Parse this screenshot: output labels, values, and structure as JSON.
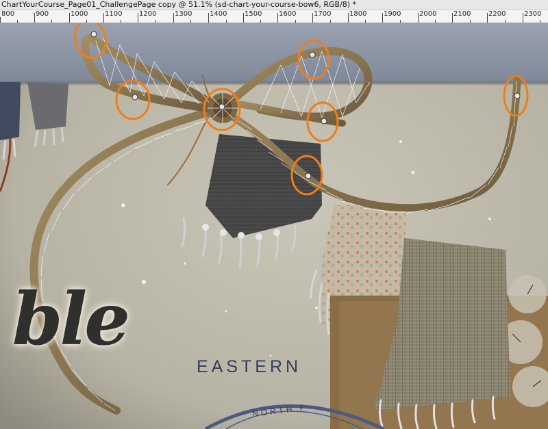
{
  "window": {
    "title": "ChartYourCourse_Page01_ChallengePage copy @ 51.1% (sd-chart-your-course-bow6, RGB/8) *"
  },
  "ruler": {
    "ticks": [
      "800",
      "900",
      "1000",
      "1100",
      "1200",
      "1300",
      "1400",
      "1500",
      "1600",
      "1700",
      "1800",
      "1900",
      "2000",
      "2100",
      "2200",
      "2300"
    ]
  },
  "canvas": {
    "eastern_text": "EASTERN",
    "north_text": "NORTH F",
    "script_text": "ble"
  },
  "colors": {
    "handle_ring": "#f07d19",
    "bow_rope": "#8a7550",
    "mesh_lines": "#ffffff",
    "paper": "#bdb9ab",
    "slate_strip": "#8a93a3"
  },
  "warp_handles": [
    "handle",
    "handle",
    "handle",
    "handle",
    "handle",
    "handle",
    "handle"
  ]
}
